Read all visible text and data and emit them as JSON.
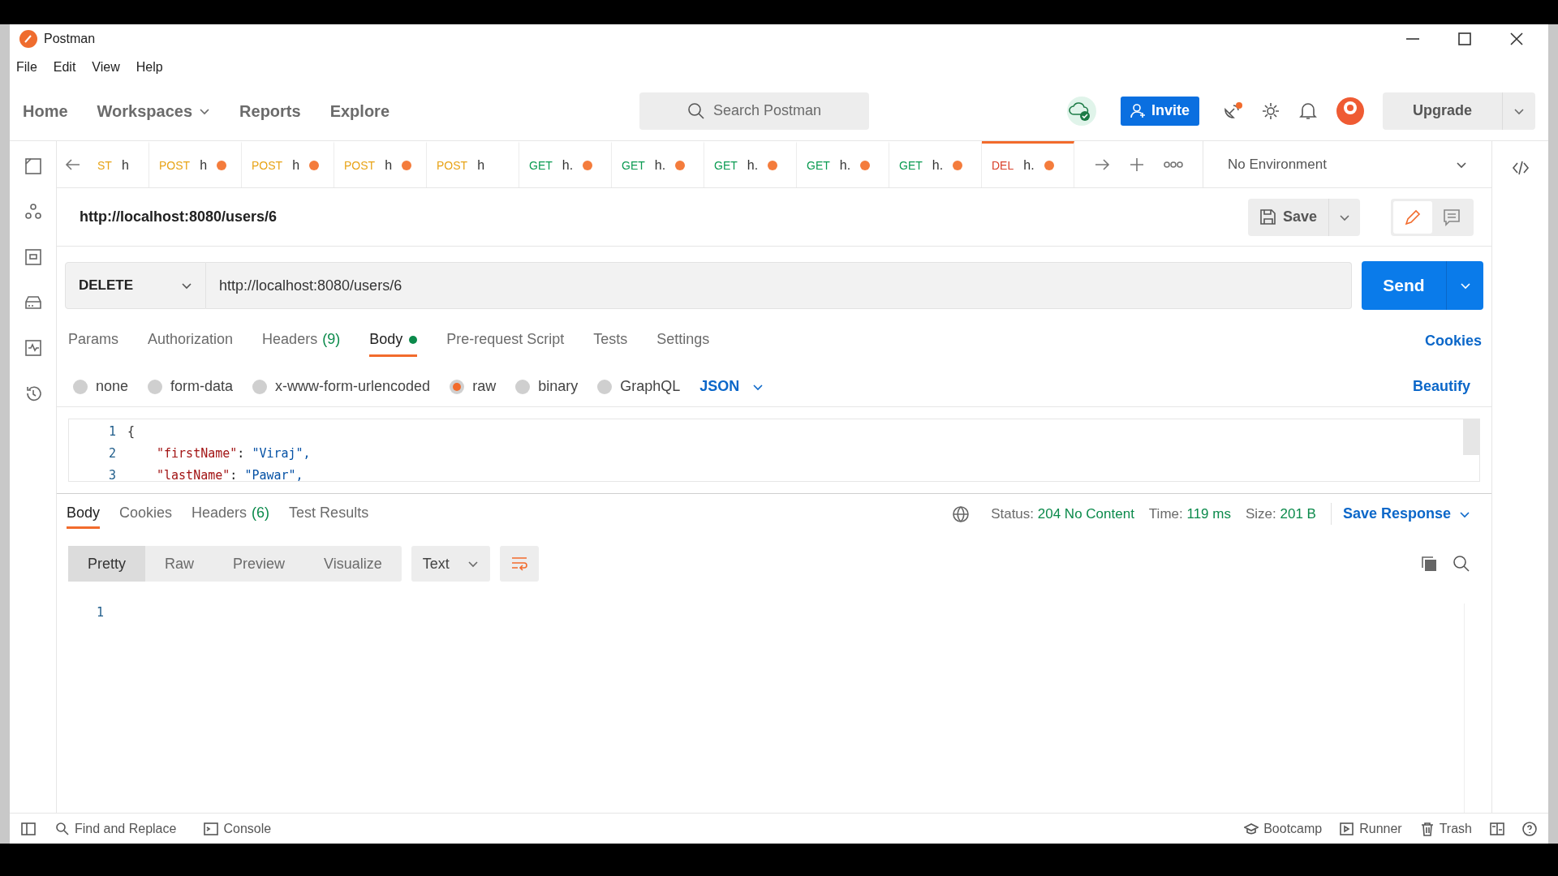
{
  "window": {
    "title": "Postman"
  },
  "menu": [
    "File",
    "Edit",
    "View",
    "Help"
  ],
  "nav": [
    {
      "label": "Home",
      "dropdown": false
    },
    {
      "label": "Workspaces",
      "dropdown": true
    },
    {
      "label": "Reports",
      "dropdown": false
    },
    {
      "label": "Explore",
      "dropdown": false
    }
  ],
  "search": {
    "placeholder": "Search Postman"
  },
  "invite": "Invite",
  "upgrade": "Upgrade",
  "tabs": [
    {
      "method": "ST",
      "label": "h",
      "color": "#e8a418",
      "dirty": false,
      "selected": false
    },
    {
      "method": "POST",
      "label": "h",
      "color": "#e8a418",
      "dirty": true,
      "selected": false
    },
    {
      "method": "POST",
      "label": "h",
      "color": "#e8a418",
      "dirty": true,
      "selected": false
    },
    {
      "method": "POST",
      "label": "h",
      "color": "#e8a418",
      "dirty": true,
      "selected": false
    },
    {
      "method": "POST",
      "label": "h",
      "color": "#e8a418",
      "dirty": false,
      "selected": false
    },
    {
      "method": "GET",
      "label": "h.",
      "color": "#0b9b52",
      "dirty": true,
      "selected": false
    },
    {
      "method": "GET",
      "label": "h.",
      "color": "#0b9b52",
      "dirty": true,
      "selected": false
    },
    {
      "method": "GET",
      "label": "h.",
      "color": "#0b9b52",
      "dirty": true,
      "selected": false
    },
    {
      "method": "GET",
      "label": "h.",
      "color": "#0b9b52",
      "dirty": true,
      "selected": false
    },
    {
      "method": "GET",
      "label": "h.",
      "color": "#0b9b52",
      "dirty": true,
      "selected": false
    },
    {
      "method": "DEL",
      "label": "h.",
      "color": "#d9412b",
      "dirty": true,
      "selected": true
    }
  ],
  "environment": "No Environment",
  "request_name": "http://localhost:8080/users/6",
  "save": "Save",
  "method": "DELETE",
  "url": "http://localhost:8080/users/6",
  "send": "Send",
  "request_tabs": [
    {
      "label": "Params",
      "dot": false,
      "selected": false
    },
    {
      "label": "Authorization",
      "dot": false,
      "selected": false
    },
    {
      "label": "Headers",
      "count": "(9)",
      "dot": false,
      "selected": false
    },
    {
      "label": "Body",
      "dot": true,
      "selected": true
    },
    {
      "label": "Pre-request Script",
      "dot": false,
      "selected": false
    },
    {
      "label": "Tests",
      "dot": false,
      "selected": false
    },
    {
      "label": "Settings",
      "dot": false,
      "selected": false
    }
  ],
  "cookies_link": "Cookies",
  "body_types": [
    {
      "label": "none",
      "selected": false
    },
    {
      "label": "form-data",
      "selected": false
    },
    {
      "label": "x-www-form-urlencoded",
      "selected": false
    },
    {
      "label": "raw",
      "selected": true
    },
    {
      "label": "binary",
      "selected": false
    },
    {
      "label": "GraphQL",
      "selected": false
    }
  ],
  "language": "JSON",
  "beautify": "Beautify",
  "editor_lines": [
    {
      "number": "1",
      "kind": "plain",
      "text": "{"
    },
    {
      "number": "2",
      "kind": "pair",
      "key": "\"firstName\"",
      "separator": ":",
      "value": "\"Viraj\","
    },
    {
      "number": "3",
      "kind": "pair",
      "key": "\"lastName\"",
      "separator": ":",
      "value": "\"Pawar\","
    }
  ],
  "response_tabs": [
    {
      "label": "Body",
      "selected": true
    },
    {
      "label": "Cookies",
      "selected": false
    },
    {
      "label": "Headers",
      "count": "(6)",
      "selected": false
    },
    {
      "label": "Test Results",
      "selected": false
    }
  ],
  "response_meta": [
    {
      "label": "Status:",
      "value": "204 No Content"
    },
    {
      "label": "Time:",
      "value": "119 ms"
    },
    {
      "label": "Size:",
      "value": "201 B"
    }
  ],
  "save_response": "Save Response",
  "view_modes": [
    {
      "label": "Pretty",
      "selected": true
    },
    {
      "label": "Raw",
      "selected": false
    },
    {
      "label": "Preview",
      "selected": false
    },
    {
      "label": "Visualize",
      "selected": false
    }
  ],
  "format": "Text",
  "response_lines": [
    "1"
  ],
  "footer_left": [
    "Find and Replace",
    "Console"
  ],
  "footer_right": [
    "Bootcamp",
    "Runner",
    "Trash"
  ]
}
